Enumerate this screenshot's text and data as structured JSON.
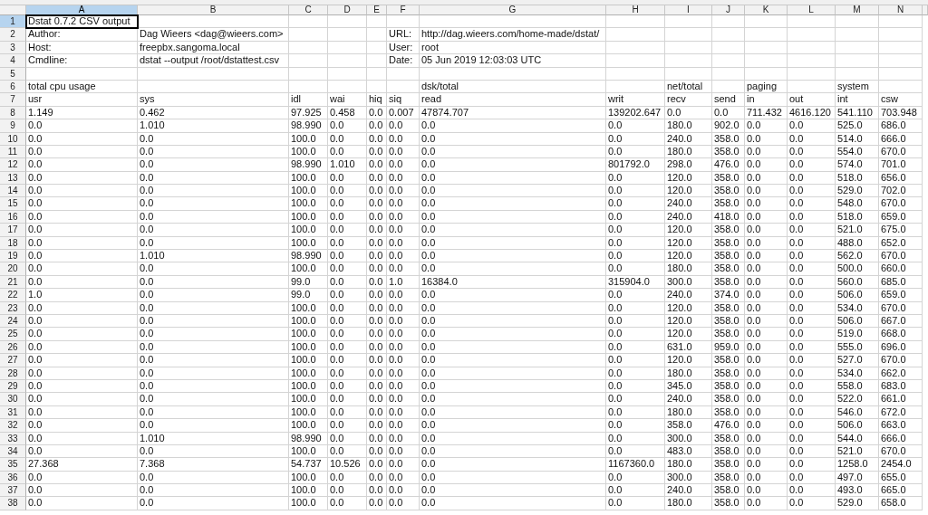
{
  "columns": [
    {
      "label": "A",
      "selected": true
    },
    {
      "label": "B",
      "selected": false
    },
    {
      "label": "C",
      "selected": false
    },
    {
      "label": "D",
      "selected": false
    },
    {
      "label": "E",
      "selected": false
    },
    {
      "label": "F",
      "selected": false
    },
    {
      "label": "G",
      "selected": false
    },
    {
      "label": "H",
      "selected": false
    },
    {
      "label": "I",
      "selected": false
    },
    {
      "label": "J",
      "selected": false
    },
    {
      "label": "K",
      "selected": false
    },
    {
      "label": "L",
      "selected": false
    },
    {
      "label": "M",
      "selected": false
    },
    {
      "label": "N",
      "selected": false
    }
  ],
  "rows": [
    {
      "number": "1",
      "selected": true,
      "cells": [
        "Dstat 0.7.2 CSV output",
        null,
        null,
        null,
        null,
        null,
        null,
        null,
        null,
        null,
        null,
        null,
        null,
        null
      ]
    },
    {
      "number": "2",
      "selected": false,
      "cells": [
        "Author:",
        "Dag Wieers <dag@wieers.com>",
        null,
        null,
        null,
        "URL:",
        "http://dag.wieers.com/home-made/dstat/",
        null,
        null,
        null,
        null,
        null,
        null,
        null
      ]
    },
    {
      "number": "3",
      "selected": false,
      "cells": [
        "Host:",
        "freepbx.sangoma.local",
        null,
        null,
        null,
        "User:",
        "root",
        null,
        null,
        null,
        null,
        null,
        null,
        null
      ]
    },
    {
      "number": "4",
      "selected": false,
      "cells": [
        "Cmdline:",
        "dstat --output /root/dstattest.csv",
        null,
        null,
        null,
        "Date:",
        "05 Jun 2019 12:03:03 UTC",
        null,
        null,
        null,
        null,
        null,
        null,
        null
      ]
    },
    {
      "number": "5",
      "selected": false,
      "cells": [
        null,
        null,
        null,
        null,
        null,
        null,
        null,
        null,
        null,
        null,
        null,
        null,
        null,
        null
      ]
    },
    {
      "number": "6",
      "selected": false,
      "cells": [
        "total cpu usage",
        null,
        null,
        null,
        null,
        null,
        "dsk/total",
        null,
        "net/total",
        null,
        "paging",
        null,
        "system",
        null
      ]
    },
    {
      "number": "7",
      "selected": false,
      "cells": [
        "usr",
        "sys",
        "idl",
        "wai",
        "hiq",
        "siq",
        "read",
        "writ",
        "recv",
        "send",
        "in",
        "out",
        "int",
        "csw"
      ]
    },
    {
      "number": "8",
      "selected": false,
      "cells": [
        "1.149",
        "0.462",
        "97.925",
        "0.458",
        "0.0",
        "0.007",
        "47874.707",
        "139202.647",
        "0.0",
        "0.0",
        "711.432",
        "4616.120",
        "541.110",
        "703.948"
      ]
    },
    {
      "number": "9",
      "selected": false,
      "cells": [
        "0.0",
        "1.010",
        "98.990",
        "0.0",
        "0.0",
        "0.0",
        "0.0",
        "0.0",
        "180.0",
        "902.0",
        "0.0",
        "0.0",
        "525.0",
        "686.0"
      ]
    },
    {
      "number": "10",
      "selected": false,
      "cells": [
        "0.0",
        "0.0",
        "100.0",
        "0.0",
        "0.0",
        "0.0",
        "0.0",
        "0.0",
        "240.0",
        "358.0",
        "0.0",
        "0.0",
        "514.0",
        "666.0"
      ]
    },
    {
      "number": "11",
      "selected": false,
      "cells": [
        "0.0",
        "0.0",
        "100.0",
        "0.0",
        "0.0",
        "0.0",
        "0.0",
        "0.0",
        "180.0",
        "358.0",
        "0.0",
        "0.0",
        "554.0",
        "670.0"
      ]
    },
    {
      "number": "12",
      "selected": false,
      "cells": [
        "0.0",
        "0.0",
        "98.990",
        "1.010",
        "0.0",
        "0.0",
        "0.0",
        "801792.0",
        "298.0",
        "476.0",
        "0.0",
        "0.0",
        "574.0",
        "701.0"
      ]
    },
    {
      "number": "13",
      "selected": false,
      "cells": [
        "0.0",
        "0.0",
        "100.0",
        "0.0",
        "0.0",
        "0.0",
        "0.0",
        "0.0",
        "120.0",
        "358.0",
        "0.0",
        "0.0",
        "518.0",
        "656.0"
      ]
    },
    {
      "number": "14",
      "selected": false,
      "cells": [
        "0.0",
        "0.0",
        "100.0",
        "0.0",
        "0.0",
        "0.0",
        "0.0",
        "0.0",
        "120.0",
        "358.0",
        "0.0",
        "0.0",
        "529.0",
        "702.0"
      ]
    },
    {
      "number": "15",
      "selected": false,
      "cells": [
        "0.0",
        "0.0",
        "100.0",
        "0.0",
        "0.0",
        "0.0",
        "0.0",
        "0.0",
        "240.0",
        "358.0",
        "0.0",
        "0.0",
        "548.0",
        "670.0"
      ]
    },
    {
      "number": "16",
      "selected": false,
      "cells": [
        "0.0",
        "0.0",
        "100.0",
        "0.0",
        "0.0",
        "0.0",
        "0.0",
        "0.0",
        "240.0",
        "418.0",
        "0.0",
        "0.0",
        "518.0",
        "659.0"
      ]
    },
    {
      "number": "17",
      "selected": false,
      "cells": [
        "0.0",
        "0.0",
        "100.0",
        "0.0",
        "0.0",
        "0.0",
        "0.0",
        "0.0",
        "120.0",
        "358.0",
        "0.0",
        "0.0",
        "521.0",
        "675.0"
      ]
    },
    {
      "number": "18",
      "selected": false,
      "cells": [
        "0.0",
        "0.0",
        "100.0",
        "0.0",
        "0.0",
        "0.0",
        "0.0",
        "0.0",
        "120.0",
        "358.0",
        "0.0",
        "0.0",
        "488.0",
        "652.0"
      ]
    },
    {
      "number": "19",
      "selected": false,
      "cells": [
        "0.0",
        "1.010",
        "98.990",
        "0.0",
        "0.0",
        "0.0",
        "0.0",
        "0.0",
        "120.0",
        "358.0",
        "0.0",
        "0.0",
        "562.0",
        "670.0"
      ]
    },
    {
      "number": "20",
      "selected": false,
      "cells": [
        "0.0",
        "0.0",
        "100.0",
        "0.0",
        "0.0",
        "0.0",
        "0.0",
        "0.0",
        "180.0",
        "358.0",
        "0.0",
        "0.0",
        "500.0",
        "660.0"
      ]
    },
    {
      "number": "21",
      "selected": false,
      "cells": [
        "0.0",
        "0.0",
        "99.0",
        "0.0",
        "0.0",
        "1.0",
        "16384.0",
        "315904.0",
        "300.0",
        "358.0",
        "0.0",
        "0.0",
        "560.0",
        "685.0"
      ]
    },
    {
      "number": "22",
      "selected": false,
      "cells": [
        "1.0",
        "0.0",
        "99.0",
        "0.0",
        "0.0",
        "0.0",
        "0.0",
        "0.0",
        "240.0",
        "374.0",
        "0.0",
        "0.0",
        "506.0",
        "659.0"
      ]
    },
    {
      "number": "23",
      "selected": false,
      "cells": [
        "0.0",
        "0.0",
        "100.0",
        "0.0",
        "0.0",
        "0.0",
        "0.0",
        "0.0",
        "120.0",
        "358.0",
        "0.0",
        "0.0",
        "534.0",
        "670.0"
      ]
    },
    {
      "number": "24",
      "selected": false,
      "cells": [
        "0.0",
        "0.0",
        "100.0",
        "0.0",
        "0.0",
        "0.0",
        "0.0",
        "0.0",
        "120.0",
        "358.0",
        "0.0",
        "0.0",
        "506.0",
        "667.0"
      ]
    },
    {
      "number": "25",
      "selected": false,
      "cells": [
        "0.0",
        "0.0",
        "100.0",
        "0.0",
        "0.0",
        "0.0",
        "0.0",
        "0.0",
        "120.0",
        "358.0",
        "0.0",
        "0.0",
        "519.0",
        "668.0"
      ]
    },
    {
      "number": "26",
      "selected": false,
      "cells": [
        "0.0",
        "0.0",
        "100.0",
        "0.0",
        "0.0",
        "0.0",
        "0.0",
        "0.0",
        "631.0",
        "959.0",
        "0.0",
        "0.0",
        "555.0",
        "696.0"
      ]
    },
    {
      "number": "27",
      "selected": false,
      "cells": [
        "0.0",
        "0.0",
        "100.0",
        "0.0",
        "0.0",
        "0.0",
        "0.0",
        "0.0",
        "120.0",
        "358.0",
        "0.0",
        "0.0",
        "527.0",
        "670.0"
      ]
    },
    {
      "number": "28",
      "selected": false,
      "cells": [
        "0.0",
        "0.0",
        "100.0",
        "0.0",
        "0.0",
        "0.0",
        "0.0",
        "0.0",
        "180.0",
        "358.0",
        "0.0",
        "0.0",
        "534.0",
        "662.0"
      ]
    },
    {
      "number": "29",
      "selected": false,
      "cells": [
        "0.0",
        "0.0",
        "100.0",
        "0.0",
        "0.0",
        "0.0",
        "0.0",
        "0.0",
        "345.0",
        "358.0",
        "0.0",
        "0.0",
        "558.0",
        "683.0"
      ]
    },
    {
      "number": "30",
      "selected": false,
      "cells": [
        "0.0",
        "0.0",
        "100.0",
        "0.0",
        "0.0",
        "0.0",
        "0.0",
        "0.0",
        "240.0",
        "358.0",
        "0.0",
        "0.0",
        "522.0",
        "661.0"
      ]
    },
    {
      "number": "31",
      "selected": false,
      "cells": [
        "0.0",
        "0.0",
        "100.0",
        "0.0",
        "0.0",
        "0.0",
        "0.0",
        "0.0",
        "180.0",
        "358.0",
        "0.0",
        "0.0",
        "546.0",
        "672.0"
      ]
    },
    {
      "number": "32",
      "selected": false,
      "cells": [
        "0.0",
        "0.0",
        "100.0",
        "0.0",
        "0.0",
        "0.0",
        "0.0",
        "0.0",
        "358.0",
        "476.0",
        "0.0",
        "0.0",
        "506.0",
        "663.0"
      ]
    },
    {
      "number": "33",
      "selected": false,
      "cells": [
        "0.0",
        "1.010",
        "98.990",
        "0.0",
        "0.0",
        "0.0",
        "0.0",
        "0.0",
        "300.0",
        "358.0",
        "0.0",
        "0.0",
        "544.0",
        "666.0"
      ]
    },
    {
      "number": "34",
      "selected": false,
      "cells": [
        "0.0",
        "0.0",
        "100.0",
        "0.0",
        "0.0",
        "0.0",
        "0.0",
        "0.0",
        "483.0",
        "358.0",
        "0.0",
        "0.0",
        "521.0",
        "670.0"
      ]
    },
    {
      "number": "35",
      "selected": false,
      "cells": [
        "27.368",
        "7.368",
        "54.737",
        "10.526",
        "0.0",
        "0.0",
        "0.0",
        "1167360.0",
        "180.0",
        "358.0",
        "0.0",
        "0.0",
        "1258.0",
        "2454.0"
      ]
    },
    {
      "number": "36",
      "selected": false,
      "cells": [
        "0.0",
        "0.0",
        "100.0",
        "0.0",
        "0.0",
        "0.0",
        "0.0",
        "0.0",
        "300.0",
        "358.0",
        "0.0",
        "0.0",
        "497.0",
        "655.0"
      ]
    },
    {
      "number": "37",
      "selected": false,
      "cells": [
        "0.0",
        "0.0",
        "100.0",
        "0.0",
        "0.0",
        "0.0",
        "0.0",
        "0.0",
        "240.0",
        "358.0",
        "0.0",
        "0.0",
        "493.0",
        "665.0"
      ]
    },
    {
      "number": "38",
      "selected": false,
      "cells": [
        "0.0",
        "0.0",
        "100.0",
        "0.0",
        "0.0",
        "0.0",
        "0.0",
        "0.0",
        "180.0",
        "358.0",
        "0.0",
        "0.0",
        "529.0",
        "658.0"
      ]
    }
  ]
}
